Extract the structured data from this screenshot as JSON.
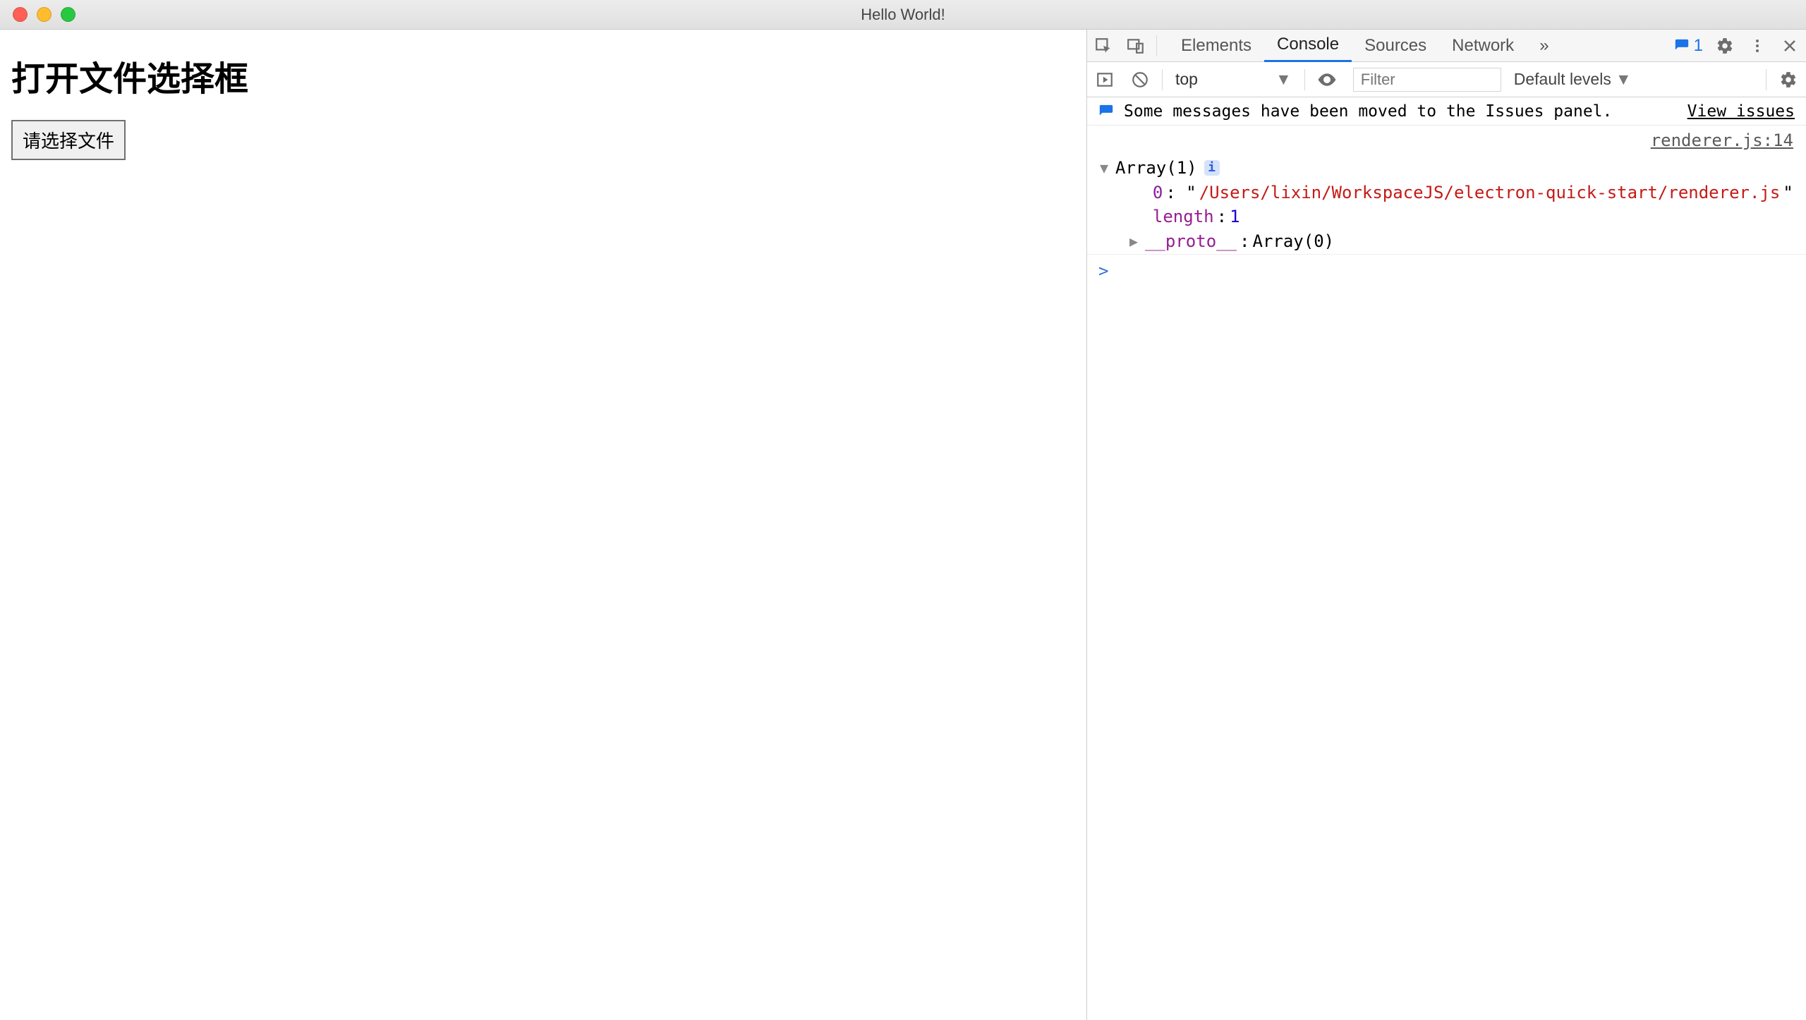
{
  "window": {
    "title": "Hello World!"
  },
  "page": {
    "heading": "打开文件选择框",
    "button_label": "请选择文件"
  },
  "devtools": {
    "tabs": {
      "elements": "Elements",
      "console": "Console",
      "sources": "Sources",
      "network": "Network"
    },
    "issues_count": "1",
    "context": "top",
    "filter_placeholder": "Filter",
    "levels_label": "Default levels",
    "issues_msg": "Some messages have been moved to the Issues panel.",
    "issues_link": "View issues",
    "source_link": "renderer.js:14",
    "log": {
      "summary": "Array(1)",
      "item_index": "0",
      "item_value": "/Users/lixin/WorkspaceJS/electron-quick-start/renderer.js",
      "length_label": "length",
      "length_value": "1",
      "proto_label": "__proto__",
      "proto_value": "Array(0)"
    },
    "prompt": ">"
  }
}
